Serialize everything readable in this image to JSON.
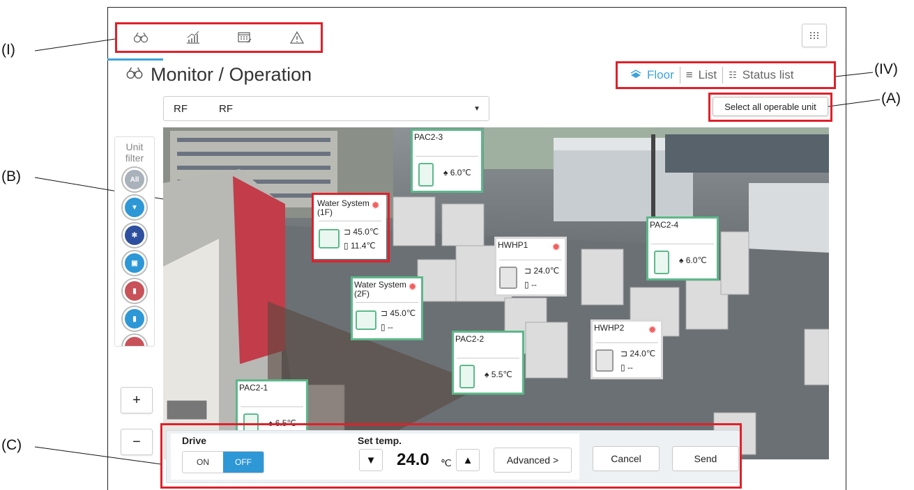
{
  "callouts": {
    "nav": "(I)",
    "view": "(IV)",
    "select_all": "(A)",
    "card": "(B)",
    "control": "(C)"
  },
  "nav_icons": [
    "binoculars-icon",
    "bar-chart-icon",
    "schedule-icon",
    "warning-icon"
  ],
  "menu_icon": "grid-menu-icon",
  "page": {
    "title": "Monitor / Operation",
    "title_icon": "binoculars-icon"
  },
  "view_tabs": [
    {
      "label": "Floor",
      "icon": "map-icon",
      "active": true
    },
    {
      "label": "List",
      "icon": "list-icon",
      "active": false
    },
    {
      "label": "Status list",
      "icon": "grid-list-icon",
      "active": false
    }
  ],
  "select_all_label": "Select all operable unit",
  "floor": {
    "code": "RF",
    "name": "RF"
  },
  "unit_filter": {
    "title_line1": "Unit",
    "title_line2": "filter",
    "buttons": [
      {
        "name": "all",
        "label": "All",
        "color": "#a9b1bb"
      },
      {
        "name": "cooling",
        "label": "",
        "color": "#2e97d6"
      },
      {
        "name": "snowflake",
        "label": "",
        "color": "#2d4f9e"
      },
      {
        "name": "building",
        "label": "",
        "color": "#2e97d6"
      },
      {
        "name": "red-unit",
        "label": "",
        "color": "#c8525a"
      },
      {
        "name": "tank",
        "label": "",
        "color": "#2e97d6"
      },
      {
        "name": "red-unit-2",
        "label": "",
        "color": "#c8525a"
      }
    ]
  },
  "zoom": {
    "in": "+",
    "out": "−"
  },
  "units": [
    {
      "name": "PAC2-3",
      "type": "pac",
      "temp": "6.0℃"
    },
    {
      "name": "Water System\n(1F)",
      "type": "water",
      "v1": "45.0℃",
      "v2": "11.4℃"
    },
    {
      "name": "PAC2-4",
      "type": "pac",
      "temp": "6.0℃"
    },
    {
      "name": "HWHP1",
      "type": "hwhp",
      "v1": "24.0℃",
      "v2": "--"
    },
    {
      "name": "Water System\n(2F)",
      "type": "water",
      "v1": "45.0℃",
      "v2": "--"
    },
    {
      "name": "HWHP2",
      "type": "hwhp",
      "v1": "24.0℃",
      "v2": "--"
    },
    {
      "name": "PAC2-2",
      "type": "pac",
      "temp": "5.5℃"
    },
    {
      "name": "PAC2-1",
      "type": "pac",
      "temp": "6.5℃"
    }
  ],
  "control": {
    "drive_label": "Drive",
    "on": "ON",
    "off": "OFF",
    "set_temp_label": "Set temp.",
    "temp_value": "24.0",
    "temp_unit": "℃",
    "down": "▼",
    "up": "▲",
    "advanced": "Advanced >",
    "cancel": "Cancel",
    "send": "Send"
  }
}
